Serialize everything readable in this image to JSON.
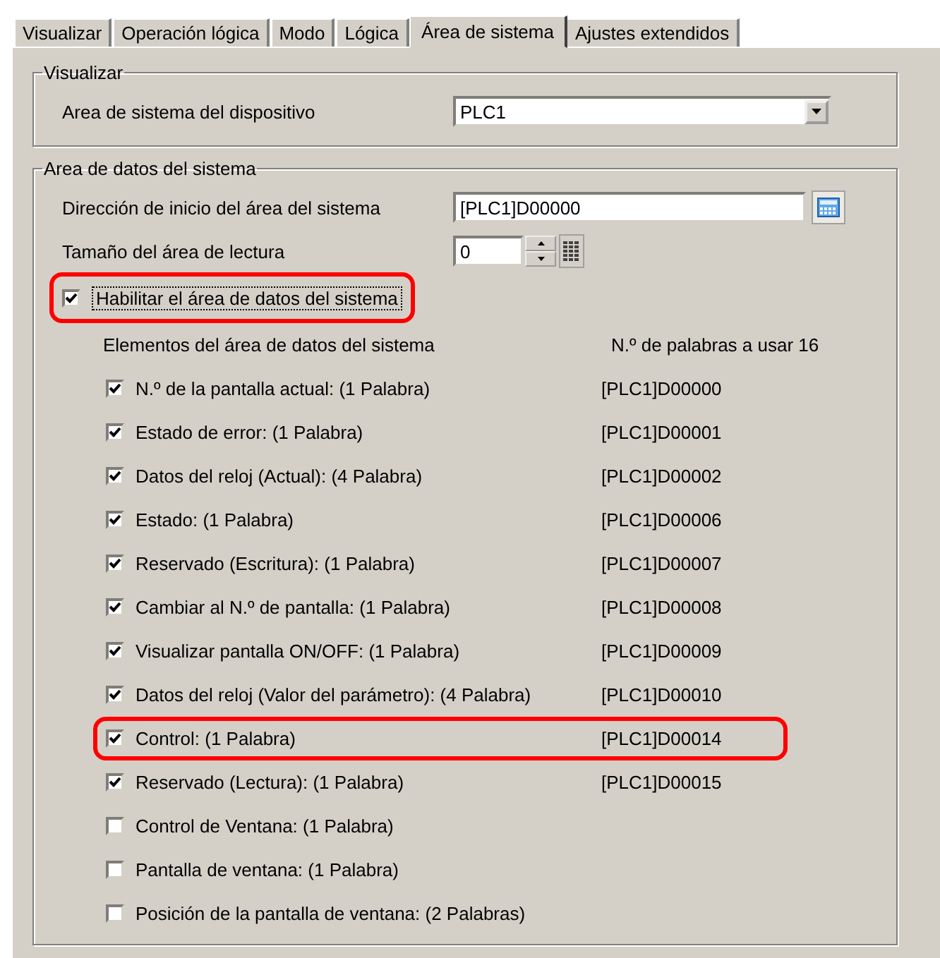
{
  "tabs": [
    {
      "label": "Visualizar",
      "selected": false
    },
    {
      "label": "Operación lógica",
      "selected": false
    },
    {
      "label": "Modo",
      "selected": false
    },
    {
      "label": "Lógica",
      "selected": false
    },
    {
      "label": "Área de sistema",
      "selected": true
    },
    {
      "label": "Ajustes extendidos",
      "selected": false
    }
  ],
  "display_group": {
    "title": "Visualizar",
    "device_area": {
      "label": "Area de sistema del dispositivo",
      "value": "PLC1"
    }
  },
  "data_group": {
    "title": "Area de datos del sistema",
    "start_address": {
      "label": "Dirección de inicio del área del sistema",
      "value": "[PLC1]D00000"
    },
    "read_size": {
      "label": "Tamaño del área de lectura",
      "value": "0"
    },
    "enable": {
      "label": "Habilitar el área de datos del sistema",
      "checked": true,
      "highlighted": true
    },
    "items_header": "Elementos del área de datos del sistema",
    "words_used": "N.º de palabras a usar 16",
    "items": [
      {
        "label": "N.º de la pantalla actual: (1 Palabra)",
        "checked": true,
        "address": "[PLC1]D00000",
        "highlighted": false
      },
      {
        "label": "Estado de error: (1 Palabra)",
        "checked": true,
        "address": "[PLC1]D00001",
        "highlighted": false
      },
      {
        "label": "Datos del reloj (Actual): (4 Palabra)",
        "checked": true,
        "address": "[PLC1]D00002",
        "highlighted": false
      },
      {
        "label": "Estado: (1 Palabra)",
        "checked": true,
        "address": "[PLC1]D00006",
        "highlighted": false
      },
      {
        "label": "Reservado (Escritura): (1 Palabra)",
        "checked": true,
        "address": "[PLC1]D00007",
        "highlighted": false
      },
      {
        "label": "Cambiar al N.º de pantalla: (1 Palabra)",
        "checked": true,
        "address": "[PLC1]D00008",
        "highlighted": false
      },
      {
        "label": "Visualizar pantalla ON/OFF: (1 Palabra)",
        "checked": true,
        "address": "[PLC1]D00009",
        "highlighted": false
      },
      {
        "label": "Datos del reloj (Valor del parámetro): (4 Palabra)",
        "checked": true,
        "address": "[PLC1]D00010",
        "highlighted": false
      },
      {
        "label": "Control: (1 Palabra)",
        "checked": true,
        "address": "[PLC1]D00014",
        "highlighted": true
      },
      {
        "label": "Reservado (Lectura): (1 Palabra)",
        "checked": true,
        "address": "[PLC1]D00015",
        "highlighted": false
      },
      {
        "label": "Control de Ventana: (1 Palabra)",
        "checked": false,
        "highlighted": false
      },
      {
        "label": "Pantalla de ventana: (1 Palabra)",
        "checked": false,
        "highlighted": false
      },
      {
        "label": "Posición de la pantalla de ventana: (2 Palabras)",
        "checked": false,
        "highlighted": false
      }
    ]
  }
}
